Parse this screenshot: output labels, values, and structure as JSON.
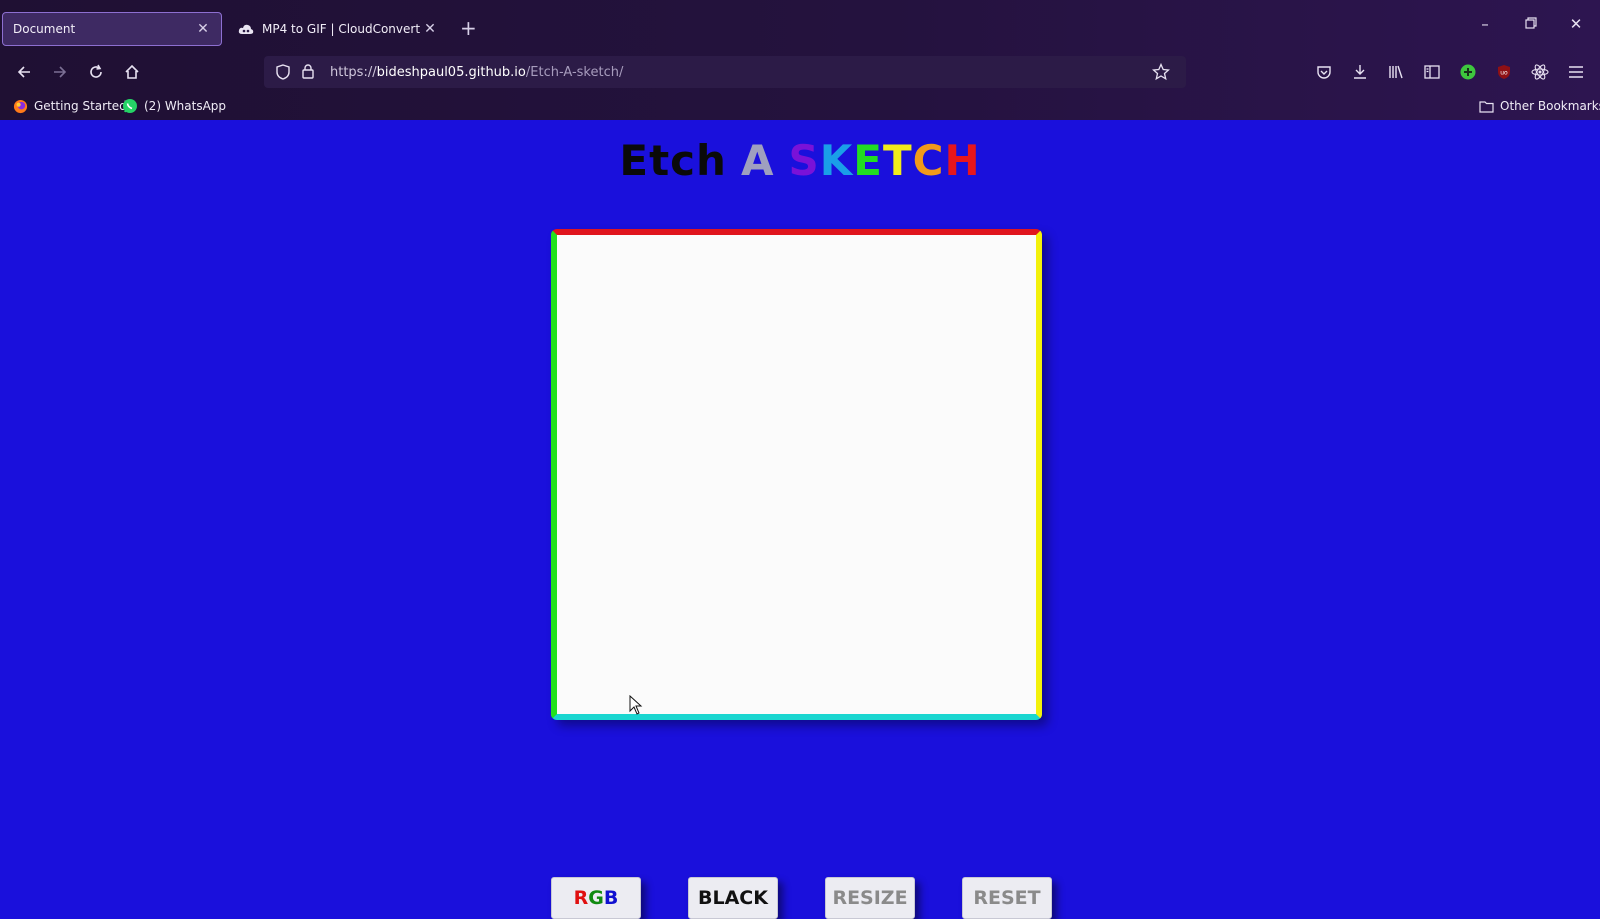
{
  "browser": {
    "tabs": [
      {
        "label": "Document",
        "active": true
      },
      {
        "label": "MP4 to GIF | CloudConvert",
        "active": false
      }
    ],
    "url": {
      "scheme": "https://",
      "host": "bideshpaul05.github.io",
      "path": "/Etch-A-sketch/"
    },
    "bookmarks": {
      "getting_started": "Getting Started",
      "whatsapp": "(2) WhatsApp",
      "other": "Other Bookmarks"
    }
  },
  "page": {
    "title_word1": "Etch",
    "title_word2": "A",
    "title_word3_letters": [
      "S",
      "K",
      "E",
      "T",
      "C",
      "H"
    ],
    "title_word3_colors": [
      "#7a12d8",
      "#1a9fe8",
      "#22dd22",
      "#f2ec1a",
      "#f29a1a",
      "#e8161c"
    ],
    "buttons": {
      "rgb": {
        "letters": [
          "R",
          "G",
          "B"
        ],
        "colors": [
          "#e01010",
          "#108a10",
          "#1010d0"
        ]
      },
      "black": "BLACK",
      "resize": "RESIZE",
      "reset": "RESET"
    },
    "colors": {
      "background": "#1a10dc",
      "board_top": "#e0151d",
      "board_left": "#22e21e",
      "board_right": "#f3f10c",
      "board_bottom": "#19d6d0"
    }
  }
}
